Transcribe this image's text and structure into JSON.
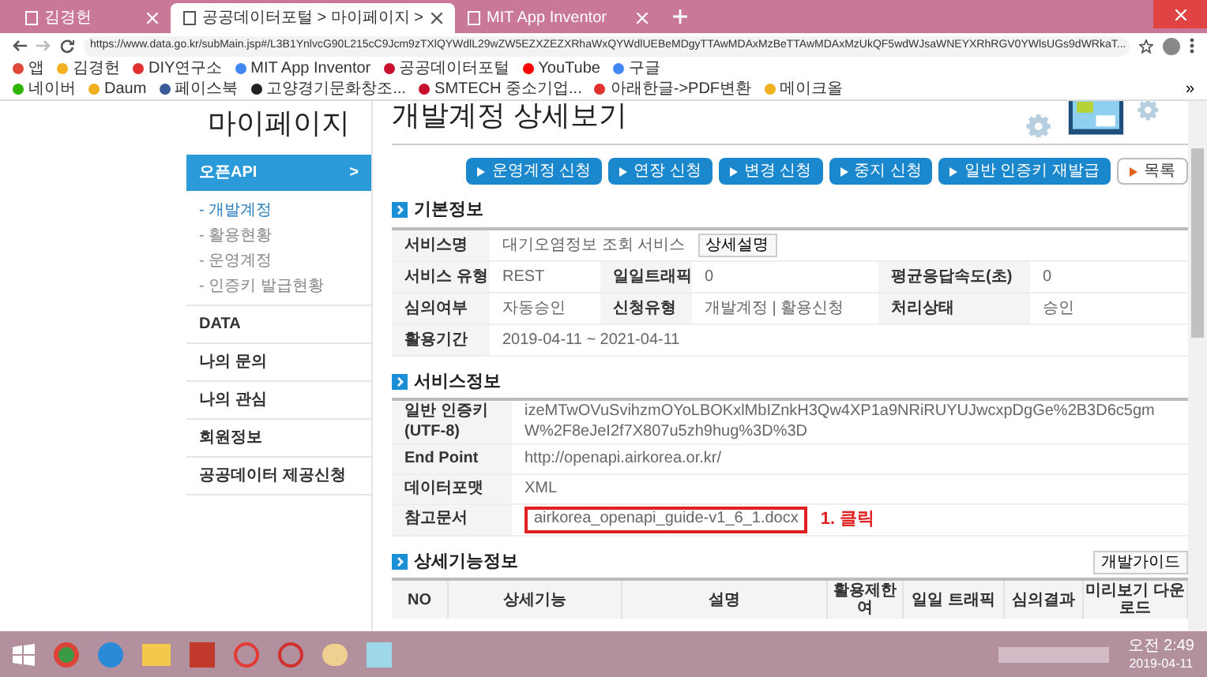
{
  "browser": {
    "tabs": [
      {
        "label": "김경헌",
        "selected": false
      },
      {
        "label": "공공데이터포털 > 마이페이지 >",
        "selected": true
      },
      {
        "label": "MIT App Inventor",
        "selected": false
      }
    ],
    "url": "https://www.data.go.kr/subMain.jsp#/L3B1YnlvcG90L215cC9Jcm9zTXlQYWdlL29wZW5EZXZEZXRhaWxQYWdlUEBeMDgyTTAwMDAxMzBeTTAwMDAxMzUkQF5wdWJsaWNEYXRhRGV0YWlsUGs9dWRkaT...",
    "bookmarks": [
      {
        "label": "앱",
        "kind": "apps"
      },
      {
        "label": "김경헌",
        "kind": "d"
      },
      {
        "label": "DIY연구소",
        "kind": "ring"
      },
      {
        "label": "MIT App Inventor",
        "kind": "g"
      },
      {
        "label": "공공데이터포털",
        "kind": "flag"
      },
      {
        "label": "YouTube",
        "kind": "yt"
      },
      {
        "label": "구글",
        "kind": "g"
      },
      {
        "label": "네이버",
        "kind": "n"
      },
      {
        "label": "Daum",
        "kind": "d"
      },
      {
        "label": "페이스북",
        "kind": "fb"
      },
      {
        "label": "고양경기문화창조...",
        "kind": "dark"
      },
      {
        "label": "SMTECH 중소기업...",
        "kind": "flag"
      },
      {
        "label": "아래한글->PDF변환",
        "kind": "ring"
      },
      {
        "label": "메이크올",
        "kind": "d"
      }
    ],
    "more": "»"
  },
  "sidebar": {
    "title": "마이페이지",
    "items": [
      {
        "label": "오픈API",
        "selected": true,
        "arrow": ">",
        "children": [
          {
            "label": "- 개발계정",
            "selected": true
          },
          {
            "label": "- 활용현황",
            "selected": false
          },
          {
            "label": "- 운영계정",
            "selected": false
          },
          {
            "label": "- 인증키 발급현황",
            "selected": false
          }
        ]
      },
      {
        "label": "DATA",
        "selected": false
      },
      {
        "label": "나의 문의",
        "selected": false
      },
      {
        "label": "나의 관심",
        "selected": false
      },
      {
        "label": "회원정보",
        "selected": false
      },
      {
        "label": "공공데이터 제공신청",
        "selected": false
      }
    ]
  },
  "main": {
    "title": "개발계정 상세보기",
    "buttons": [
      {
        "label": "운영계정 신청",
        "kind": "primary"
      },
      {
        "label": "연장 신청",
        "kind": "primary"
      },
      {
        "label": "변경 신청",
        "kind": "primary"
      },
      {
        "label": "중지 신청",
        "kind": "primary"
      },
      {
        "label": "일반 인증키 재발급",
        "kind": "primary"
      },
      {
        "label": "목록",
        "kind": "secondary"
      }
    ],
    "basic_info": {
      "heading": "기본정보",
      "rows": [
        [
          {
            "label": "서비스명",
            "value": "대기오염정보 조회 서비스",
            "button": "상세설명"
          }
        ],
        [
          {
            "label": "서비스 유형",
            "value": "REST"
          },
          {
            "label": "일일트래픽",
            "value": "0"
          },
          {
            "label": "평균응답속도(초)",
            "value": "0"
          }
        ],
        [
          {
            "label": "심의여부",
            "value": "자동승인"
          },
          {
            "label": "신청유형",
            "value": "개발계정 | 활용신청"
          },
          {
            "label": "처리상태",
            "value": "승인"
          }
        ],
        [
          {
            "label": "활용기간",
            "value": "2019-04-11 ~ 2021-04-11"
          }
        ]
      ]
    },
    "service_info": {
      "heading": "서비스정보",
      "rows": [
        {
          "label": "일반 인증키 (UTF-8)",
          "value": "izeMTwOVuSvihzmOYoLBOKxlMbIZnkH3Qw4XP1a9NRiRUYUJwcxpDgGe%2B3D6c5gmW%2F8eJeI2f7X807u5zh9hug%3D%3D",
          "highlighted": false
        },
        {
          "label": "End Point",
          "value": "http://openapi.airkorea.or.kr/",
          "highlighted": false
        },
        {
          "label": "데이터포맷",
          "value": "XML",
          "highlighted": false
        },
        {
          "label": "참고문서",
          "value": "airkorea_openapi_guide-v1_6_1.docx",
          "highlighted": true,
          "annotation": "1. 클릭"
        }
      ]
    },
    "detail_info": {
      "heading": "상세기능정보",
      "guide_button": "개발가이드",
      "columns": [
        "NO",
        "상세기능",
        "설명",
        "활용제한 여",
        "일일 트래픽",
        "심의결과",
        "미리보기 다운로드"
      ]
    }
  },
  "taskbar": {
    "time": "오전 2:49",
    "date": "2019-04-11"
  }
}
